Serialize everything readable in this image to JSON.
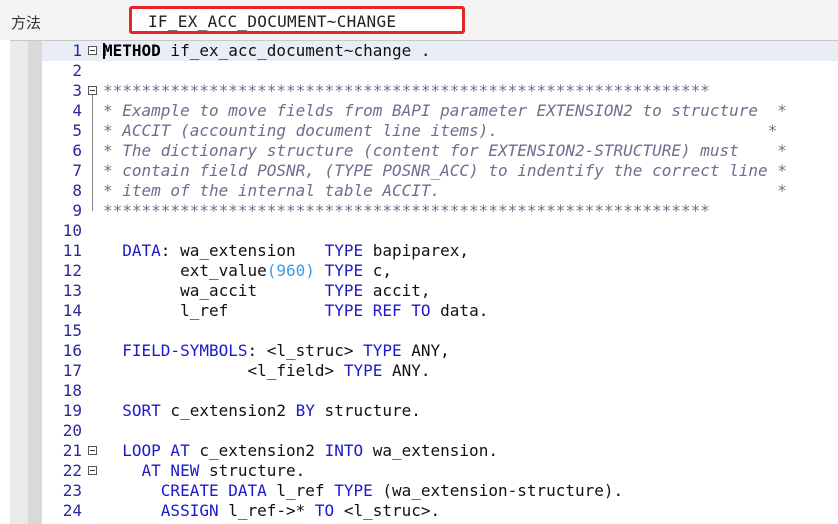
{
  "header": {
    "label": "方法",
    "method_name": "IF_EX_ACC_DOCUMENT~CHANGE"
  },
  "lines": [
    {
      "n": "1",
      "segs": [
        {
          "t": "METHOD",
          "c": "bold"
        },
        {
          "t": " if_ex_acc_document~change .",
          "c": ""
        }
      ]
    },
    {
      "n": "2",
      "segs": []
    },
    {
      "n": "3",
      "segs": [
        {
          "t": "***************************************************************",
          "c": "cm"
        }
      ]
    },
    {
      "n": "4",
      "segs": [
        {
          "t": "* Example to move fields from BAPI parameter EXTENSION2 to structure  *",
          "c": "cm"
        }
      ]
    },
    {
      "n": "5",
      "segs": [
        {
          "t": "* ACCIT (accounting document line items).                            *",
          "c": "cm"
        }
      ]
    },
    {
      "n": "6",
      "segs": [
        {
          "t": "* The dictionary structure (content for EXTENSION2-STRUCTURE) must    *",
          "c": "cm"
        }
      ]
    },
    {
      "n": "7",
      "segs": [
        {
          "t": "* contain field POSNR, (TYPE POSNR_ACC) to indentify the correct line *",
          "c": "cm"
        }
      ]
    },
    {
      "n": "8",
      "segs": [
        {
          "t": "* item of the internal table ACCIT.                                   *",
          "c": "cm"
        }
      ]
    },
    {
      "n": "9",
      "segs": [
        {
          "t": "***************************************************************",
          "c": "cm"
        }
      ]
    },
    {
      "n": "10",
      "segs": []
    },
    {
      "n": "11",
      "segs": [
        {
          "t": "  ",
          "c": ""
        },
        {
          "t": "DATA",
          "c": "kw"
        },
        {
          "t": ": wa_extension   ",
          "c": ""
        },
        {
          "t": "TYPE",
          "c": "kw"
        },
        {
          "t": " bapiparex,",
          "c": ""
        }
      ]
    },
    {
      "n": "12",
      "segs": [
        {
          "t": "        ext_value",
          "c": ""
        },
        {
          "t": "(960)",
          "c": "num"
        },
        {
          "t": " ",
          "c": ""
        },
        {
          "t": "TYPE",
          "c": "kw"
        },
        {
          "t": " c,",
          "c": ""
        }
      ]
    },
    {
      "n": "13",
      "segs": [
        {
          "t": "        wa_accit       ",
          "c": ""
        },
        {
          "t": "TYPE",
          "c": "kw"
        },
        {
          "t": " accit,",
          "c": ""
        }
      ]
    },
    {
      "n": "14",
      "segs": [
        {
          "t": "        l_ref          ",
          "c": ""
        },
        {
          "t": "TYPE REF TO",
          "c": "kw"
        },
        {
          "t": " data.",
          "c": ""
        }
      ]
    },
    {
      "n": "15",
      "segs": []
    },
    {
      "n": "16",
      "segs": [
        {
          "t": "  ",
          "c": ""
        },
        {
          "t": "FIELD-SYMBOLS",
          "c": "kw"
        },
        {
          "t": ": <l_struc> ",
          "c": ""
        },
        {
          "t": "TYPE",
          "c": "kw"
        },
        {
          "t": " ANY,",
          "c": ""
        }
      ]
    },
    {
      "n": "17",
      "segs": [
        {
          "t": "               <l_field> ",
          "c": ""
        },
        {
          "t": "TYPE",
          "c": "kw"
        },
        {
          "t": " ANY.",
          "c": ""
        }
      ]
    },
    {
      "n": "18",
      "segs": []
    },
    {
      "n": "19",
      "segs": [
        {
          "t": "  ",
          "c": ""
        },
        {
          "t": "SORT",
          "c": "kw"
        },
        {
          "t": " c_extension2 ",
          "c": ""
        },
        {
          "t": "BY",
          "c": "kw"
        },
        {
          "t": " structure.",
          "c": ""
        }
      ]
    },
    {
      "n": "20",
      "segs": []
    },
    {
      "n": "21",
      "segs": [
        {
          "t": "  ",
          "c": ""
        },
        {
          "t": "LOOP AT",
          "c": "kw"
        },
        {
          "t": " c_extension2 ",
          "c": ""
        },
        {
          "t": "INTO",
          "c": "kw"
        },
        {
          "t": " wa_extension.",
          "c": ""
        }
      ]
    },
    {
      "n": "22",
      "segs": [
        {
          "t": "    ",
          "c": ""
        },
        {
          "t": "AT NEW",
          "c": "kw"
        },
        {
          "t": " structure.",
          "c": ""
        }
      ]
    },
    {
      "n": "23",
      "segs": [
        {
          "t": "      ",
          "c": ""
        },
        {
          "t": "CREATE DATA",
          "c": "kw"
        },
        {
          "t": " l_ref ",
          "c": ""
        },
        {
          "t": "TYPE",
          "c": "kw"
        },
        {
          "t": " (wa_extension-structure).",
          "c": ""
        }
      ]
    },
    {
      "n": "24",
      "segs": [
        {
          "t": "      ",
          "c": ""
        },
        {
          "t": "ASSIGN",
          "c": "kw"
        },
        {
          "t": " l_ref->* ",
          "c": ""
        },
        {
          "t": "TO",
          "c": "kw"
        },
        {
          "t": " <l_struc>.",
          "c": ""
        }
      ]
    }
  ],
  "folds": [
    "1",
    "3",
    "21",
    "22"
  ]
}
